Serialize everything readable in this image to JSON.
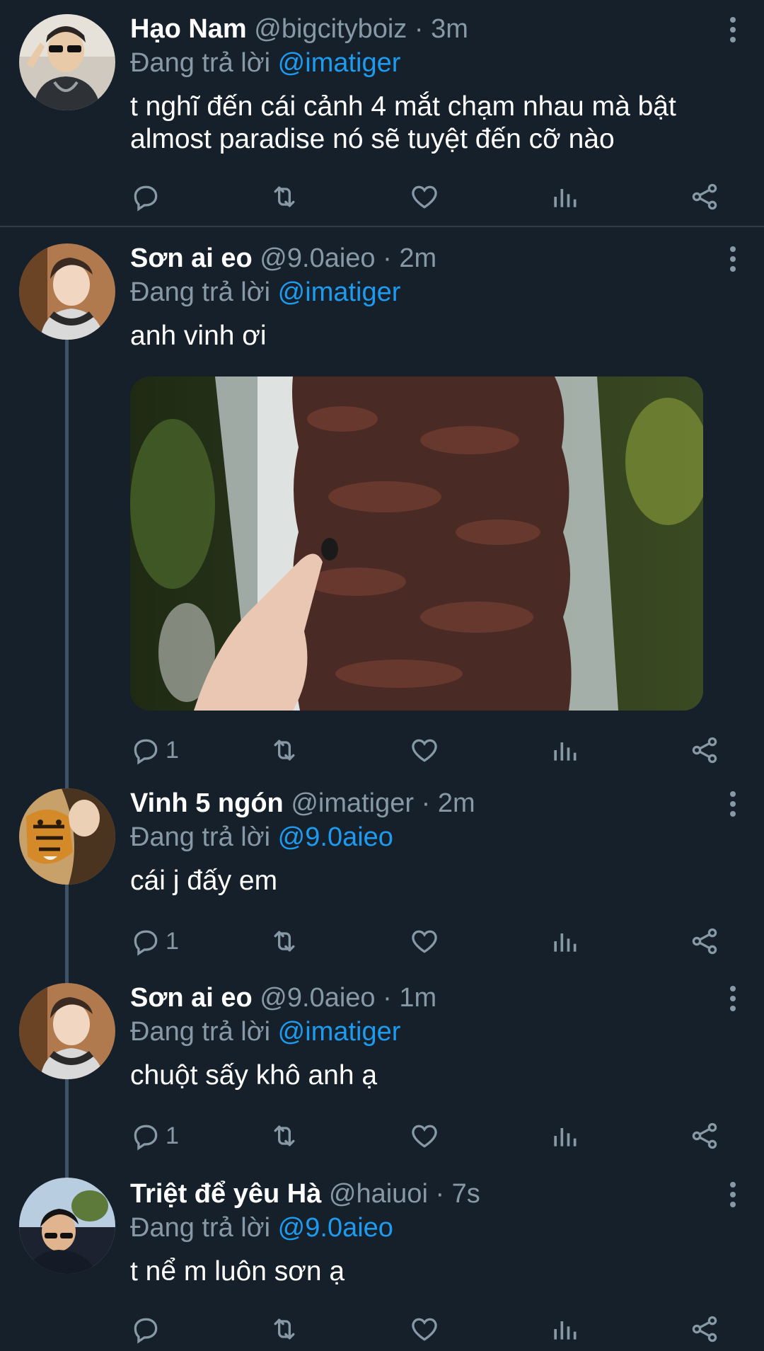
{
  "replying_label": "Đang trả lời",
  "tweets": [
    {
      "name": "Hạo Nam",
      "handle": "@bigcityboiz",
      "time": "3m",
      "reply_to": "@imatiger",
      "text_lines": [
        "t nghĩ đến cái cảnh 4 mắt chạm nhau mà bật",
        "almost paradise nó sẽ tuyệt đến cỡ nào"
      ],
      "reply_count": ""
    },
    {
      "name": "Sơn ai eo",
      "handle": "@9.0aieo",
      "time": "2m",
      "reply_to": "@imatiger",
      "text_lines": [
        "anh vinh ơi"
      ],
      "reply_count": "1"
    },
    {
      "name": "Vinh 5 ngón",
      "handle": "@imatiger",
      "time": "2m",
      "reply_to": "@9.0aieo",
      "text_lines": [
        "cái j đấy em"
      ],
      "reply_count": "1"
    },
    {
      "name": "Sơn ai eo",
      "handle": "@9.0aieo",
      "time": "1m",
      "reply_to": "@imatiger",
      "text_lines": [
        "chuột sấy khô anh ạ"
      ],
      "reply_count": "1"
    },
    {
      "name": "Triệt để yêu Hà",
      "handle": "@haiuoi",
      "time": "7s",
      "reply_to": "@9.0aieo",
      "text_lines": [
        "t nể m luôn sơn ạ"
      ],
      "reply_count": ""
    }
  ],
  "icons": {
    "reply": "reply-icon",
    "retweet": "retweet-icon",
    "like": "heart-icon",
    "views": "analytics-icon",
    "share": "share-icon",
    "more": "more-vertical-icon"
  },
  "colors": {
    "background": "#15202b",
    "text": "#ffffff",
    "secondary": "#8899a6",
    "accent": "#1d9bf0"
  }
}
